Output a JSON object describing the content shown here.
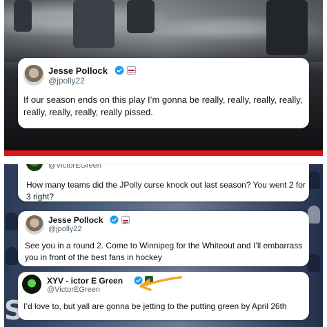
{
  "colors": {
    "verified_blue": "#1d9bf0",
    "text_primary": "#0f1419",
    "text_secondary": "#536471",
    "accent_red": "#d21a1a",
    "arrow_orange": "#f5a623"
  },
  "tweets": [
    {
      "name": "Jesse Pollock",
      "handle": "@jpolly22",
      "text": "If our season ends on this play I’m gonna be really, really, really, really, really, really, really, really pissed.",
      "verified_icon": "verified-badge-icon",
      "affiliate_icon": "affiliate-badge-icon"
    },
    {
      "handle": "@VictorEGreen",
      "text": "How many teams did the JPolly curse knock out last season? You went 2 for 3 right?"
    },
    {
      "name": "Jesse Pollock",
      "handle": "@jpolly22",
      "text": "See you in a round 2. Come to Winnipeg for the Whiteout and I’ll embarrass you in front of the best fans in hockey",
      "verified_icon": "verified-badge-icon",
      "affiliate_icon": "affiliate-badge-icon"
    },
    {
      "name": "XYV - ictor E Green",
      "handle": "@VictorEGreen",
      "text": "I’d love to, but yall are gonna be jetting to the putting green by April 26th",
      "verified_icon": "verified-badge-icon",
      "affiliate_icon": "affiliate-badge-icon"
    }
  ],
  "background": {
    "sponsor_text": "S"
  }
}
